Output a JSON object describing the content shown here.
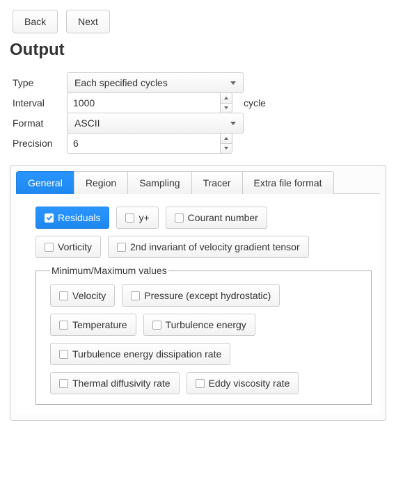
{
  "nav": {
    "back": "Back",
    "next": "Next"
  },
  "heading": "Output",
  "fields": {
    "type": {
      "label": "Type",
      "value": "Each specified cycles"
    },
    "interval": {
      "label": "Interval",
      "value": "1000",
      "unit": "cycle"
    },
    "format": {
      "label": "Format",
      "value": "ASCII"
    },
    "precision": {
      "label": "Precision",
      "value": "6"
    }
  },
  "tabs": {
    "general": "General",
    "region": "Region",
    "sampling": "Sampling",
    "tracer": "Tracer",
    "extra": "Extra file format"
  },
  "general_panel": {
    "residuals": "Residuals",
    "yplus": "y+",
    "courant": "Courant number",
    "vorticity": "Vorticity",
    "second_inv": "2nd invariant of velocity gradient tensor",
    "minmax_legend": "Minimum/Maximum values",
    "velocity": "Velocity",
    "pressure": "Pressure (except hydrostatic)",
    "temperature": "Temperature",
    "turb_energy": "Turbulence energy",
    "turb_diss": "Turbulence energy dissipation rate",
    "thermal_diff": "Thermal diffusivity rate",
    "eddy_visc": "Eddy viscosity rate"
  }
}
